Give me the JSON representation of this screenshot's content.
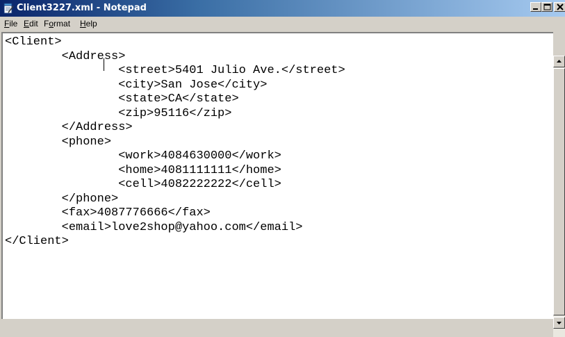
{
  "window": {
    "title": "Client3227.xml - Notepad",
    "app_icon": "notepad-icon",
    "controls": [
      "minimize-icon",
      "maximize-icon",
      "close-icon"
    ]
  },
  "menu": {
    "file": {
      "mnemonic": "F",
      "rest": "ile"
    },
    "edit": {
      "mnemonic": "E",
      "rest": "dit"
    },
    "format": {
      "before": "F",
      "mnemonic": "o",
      "rest": "rmat"
    },
    "help": {
      "mnemonic": "H",
      "rest": "elp"
    }
  },
  "editor": {
    "content": "<Client> \n        <Address>\n                <street>5401 Julio Ave.</street>\n                <city>San Jose</city>\n                <state>CA</state>\n                <zip>95116</zip>\n        </Address>\n        <phone>\n                <work>4084630000</work>\n                <home>4081111111</home>\n                <cell>4082222222</cell>\n        </phone>\n        <fax>4087776666</fax>\n        <email>love2shop@yahoo.com</email>\n</Client>"
  },
  "scrollbar": {
    "up_icon": "arrow-up-icon",
    "down_icon": "arrow-down-icon"
  }
}
